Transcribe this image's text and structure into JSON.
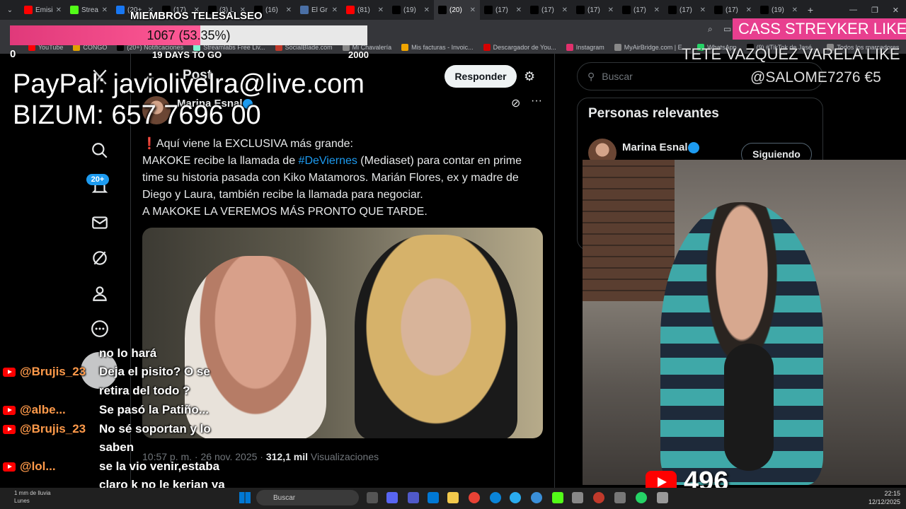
{
  "browser": {
    "tabs": [
      {
        "label": "Emisi",
        "color": "#ff0000",
        "active": false
      },
      {
        "label": "Strea",
        "color": "#53fc18",
        "active": false
      },
      {
        "label": "(20+",
        "color": "#1877f2",
        "active": false
      },
      {
        "label": "(17)",
        "color": "#000000",
        "active": false
      },
      {
        "label": "(3) L",
        "color": "#000000",
        "active": false
      },
      {
        "label": "(16)",
        "color": "#000000",
        "active": false
      },
      {
        "label": "El Gr",
        "color": "#4a6fa5",
        "active": false
      },
      {
        "label": "(81)",
        "color": "#ff0000",
        "active": false
      },
      {
        "label": "(19)",
        "color": "#000000",
        "active": false
      },
      {
        "label": "(20)",
        "color": "#000000",
        "active": true
      },
      {
        "label": "(17)",
        "color": "#000000",
        "active": false
      },
      {
        "label": "(17)",
        "color": "#000000",
        "active": false
      },
      {
        "label": "(17)",
        "color": "#000000",
        "active": false
      },
      {
        "label": "(17)",
        "color": "#000000",
        "active": false
      },
      {
        "label": "(17)",
        "color": "#000000",
        "active": false
      },
      {
        "label": "(17)",
        "color": "#000000",
        "active": false
      },
      {
        "label": "(19)",
        "color": "#000000",
        "active": false
      }
    ],
    "bookmarks": [
      {
        "label": "YouTube",
        "color": "#ff0000"
      },
      {
        "label": "CONGO",
        "color": "#e0a000"
      },
      {
        "label": "(20+) Notificaciones",
        "color": "#000000"
      },
      {
        "label": "Streamlabs Free Liv...",
        "color": "#80f5d2"
      },
      {
        "label": "SocialBlade.com",
        "color": "#c0392b"
      },
      {
        "label": "Mi Chavalería",
        "color": "#888888"
      },
      {
        "label": "Mis facturas - Invoic...",
        "color": "#f0a500"
      },
      {
        "label": "Descargador de You...",
        "color": "#d40000"
      },
      {
        "label": "Instagram",
        "color": "#e1306c"
      },
      {
        "label": "MyAirBridge.com | E...",
        "color": "#888888"
      },
      {
        "label": "WhatsApp",
        "color": "#25d366"
      },
      {
        "label": "(9) #TikTok de Jasé...",
        "color": "#000000"
      },
      {
        "label": "Todos los marcadores",
        "color": "#888888"
      }
    ]
  },
  "overlay": {
    "members_title": "MIEMBROS TELESALSEO",
    "goal_text": "1067 (53.35%)",
    "goal_fraction": 0.5335,
    "goal_min": "0",
    "goal_days": "19 DAYS TO GO",
    "goal_max": "2000",
    "paypal": "PayPal: javiolivelra@live.com",
    "bizum": "BIZUM: 657 7696 00",
    "like_primary": "CASS STREYKER  LIKE",
    "like_secondary": "TETE VAZQUEZ VARELA  LIKE",
    "donation": "@SALOME7276  €5",
    "viewer_count": "496"
  },
  "twitter": {
    "header_title": "Post",
    "reply_label": "Responder",
    "author_name": "Marina Esnal",
    "tweet_lines": [
      "❗Aquí viene la EXCLUSIVA más grande:",
      "MAKOKE recibe la llamada de ",
      "#DeViernes",
      " (Mediaset) para contar en prime time su historia pasada con Kiko Matamoros. Marián Flores, ex y madre de Diego y Laura, también recibe la llamada para negociar.",
      "A MAKOKE LA VEREMOS MÁS PRONTO QUE TARDE."
    ],
    "meta_time": "10:57 p. m. · 26 nov. 2025 · ",
    "meta_views": "312,1 mil",
    "meta_views_label": " Visualizaciones",
    "search_placeholder": "Buscar",
    "relevant_title": "Personas relevantes",
    "relevant_name": "Marina Esnal",
    "follow_label": "Siguiendo",
    "notification_badge": "20+"
  },
  "chat": [
    {
      "user": "",
      "message": "no lo hará"
    },
    {
      "user": "@Brujis_23",
      "message": "Deja el pisito? O se"
    },
    {
      "user": "",
      "message": "retira del todo ?"
    },
    {
      "user": "@albe...",
      "message": "Se pasó la Patiño..."
    },
    {
      "user": "@Brujis_23",
      "message": "No sé soportan y lo"
    },
    {
      "user": "",
      "message": "saben"
    },
    {
      "user": "@lol...",
      "message": "se la vio venir,estaba"
    },
    {
      "user": "",
      "message": "claro k no le kerian ya"
    }
  ],
  "taskbar": {
    "weather_line1": "1 mm de lluvia",
    "weather_line2": "Lunes",
    "search_label": "Buscar",
    "time": "22:15",
    "date": "12/12/2025"
  }
}
